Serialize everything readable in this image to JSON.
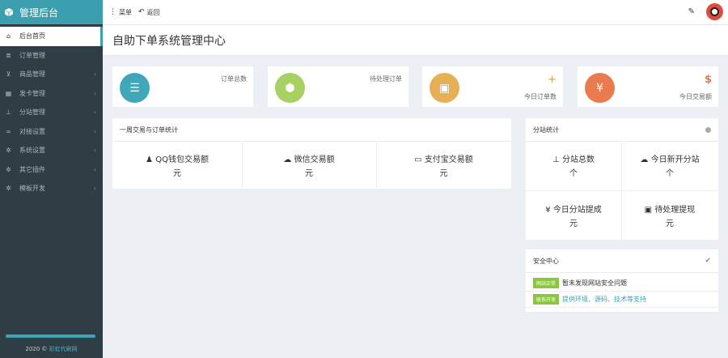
{
  "brand": {
    "title": "管理后台"
  },
  "sidebar": {
    "items": [
      {
        "label": "后台首页",
        "icon": "home-icon"
      },
      {
        "label": "订单管理",
        "icon": "list-icon"
      },
      {
        "label": "商品管理",
        "icon": "cart-icon"
      },
      {
        "label": "发卡管理",
        "icon": "grid-icon"
      },
      {
        "label": "分站管理",
        "icon": "sitemap-icon"
      },
      {
        "label": "对接设置",
        "icon": "link-icon"
      },
      {
        "label": "系统设置",
        "icon": "gear-icon"
      },
      {
        "label": "其它插件",
        "icon": "gears-icon"
      },
      {
        "label": "模板开发",
        "icon": "gears-icon"
      }
    ],
    "footer_year": "2020 ©",
    "footer_link": "彩虹代刷网"
  },
  "topbar": {
    "menu_label": "菜单",
    "back_label": "返回"
  },
  "page": {
    "title": "自助下单系统管理中心"
  },
  "stats": [
    {
      "label": "订单总数",
      "color": "#3fa7b8"
    },
    {
      "label": "待处理订单",
      "color": "#a7d163"
    },
    {
      "label": "今日订单数",
      "mark": "+",
      "color": "#e6b054"
    },
    {
      "label": "今日交易额",
      "mark": "$",
      "color": "#e97b4f"
    }
  ],
  "trade_panel": {
    "title": "一周交易与订单统计",
    "cells": [
      {
        "label": "QQ钱包交易额",
        "unit": "元"
      },
      {
        "label": "微信交易额",
        "unit": "元"
      },
      {
        "label": "支付宝交易额",
        "unit": "元"
      }
    ]
  },
  "branch_panel": {
    "title": "分站统计",
    "cells": [
      {
        "label": "分站总数",
        "unit": "个"
      },
      {
        "label": "今日新开分站",
        "unit": "个"
      },
      {
        "label": "今日分站提成",
        "unit": "元"
      },
      {
        "label": "待处理提现",
        "unit": "元"
      }
    ]
  },
  "security_panel": {
    "title": "安全中心",
    "rows": [
      {
        "tag": "网站正常",
        "text": "暂未发现网站安全问题"
      },
      {
        "tag": "联系开发",
        "text": "提供环境、源码、技术等支持"
      }
    ]
  }
}
